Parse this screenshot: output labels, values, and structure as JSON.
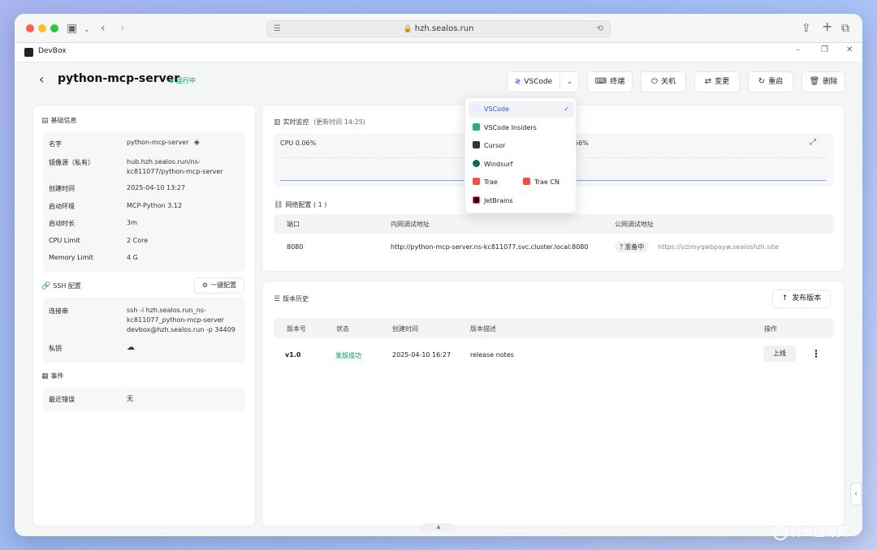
{
  "browser": {
    "url": "hzh.sealos.run"
  },
  "app": {
    "title": "DevBox"
  },
  "header": {
    "project_name": "python-mcp-server",
    "status": "运行中",
    "ide_button": "VSCode",
    "buttons": {
      "terminal": "终端",
      "shutdown": "关机",
      "change": "变更",
      "restart": "重启",
      "delete": "删除"
    }
  },
  "basic_info": {
    "title": "基础信息",
    "rows": [
      {
        "label": "名字",
        "value": "python-mcp-server"
      },
      {
        "label": "镜像源（私有）",
        "value": "hub.hzh.sealos.run/ns-kc811077/python-mcp-server"
      },
      {
        "label": "创建时间",
        "value": "2025-04-10 13:27"
      },
      {
        "label": "启动环境",
        "value": "MCP-Python 3.12"
      },
      {
        "label": "启动时长",
        "value": "3m"
      },
      {
        "label": "CPU Limit",
        "value": "2 Core"
      },
      {
        "label": "Memory Limit",
        "value": "4 G"
      }
    ]
  },
  "ssh": {
    "title": "SSH 配置",
    "config_button": "一键配置",
    "connect_label": "连接串",
    "connect_value": "ssh -i hzh.sealos.run_ns-kc811077_python-mcp-server devbox@hzh.sealos.run -p 34409",
    "key_label": "私钥"
  },
  "events": {
    "title": "事件",
    "recent_error_label": "最近错误",
    "recent_error_value": "无"
  },
  "monitor": {
    "title": "实时监控",
    "updated": "(更新时间 14:25)",
    "cpu": "CPU 0.06%",
    "mem_partial": "56%"
  },
  "network": {
    "title": "网络配置 ( 1 )",
    "columns": [
      "端口",
      "内网调试地址",
      "公网调试地址"
    ],
    "rows": [
      {
        "port": "8080",
        "internal": "http://python-mcp-server.ns-kc811077.svc.cluster.local:8080",
        "public_status": "准备中",
        "public_url": "https://vzimyqwbpayw.sealoshzh.site"
      }
    ]
  },
  "history": {
    "title": "版本历史",
    "publish_button": "发布版本",
    "columns": [
      "版本号",
      "状态",
      "创建时间",
      "版本描述",
      "操作"
    ],
    "rows": [
      {
        "version": "v1.0",
        "status": "发版成功",
        "created": "2025-04-10 16:27",
        "desc": "release notes",
        "action": "上线"
      }
    ]
  },
  "ide_menu": {
    "items": [
      "VSCode",
      "VSCode Insiders",
      "Cursor",
      "Windsurf",
      "Trae",
      "Trae CN",
      "JetBrains"
    ]
  },
  "watermark": "什么值得买",
  "colors": {
    "accent": "#2f54eb",
    "success": "#039855",
    "background": "#f4f5f7"
  }
}
